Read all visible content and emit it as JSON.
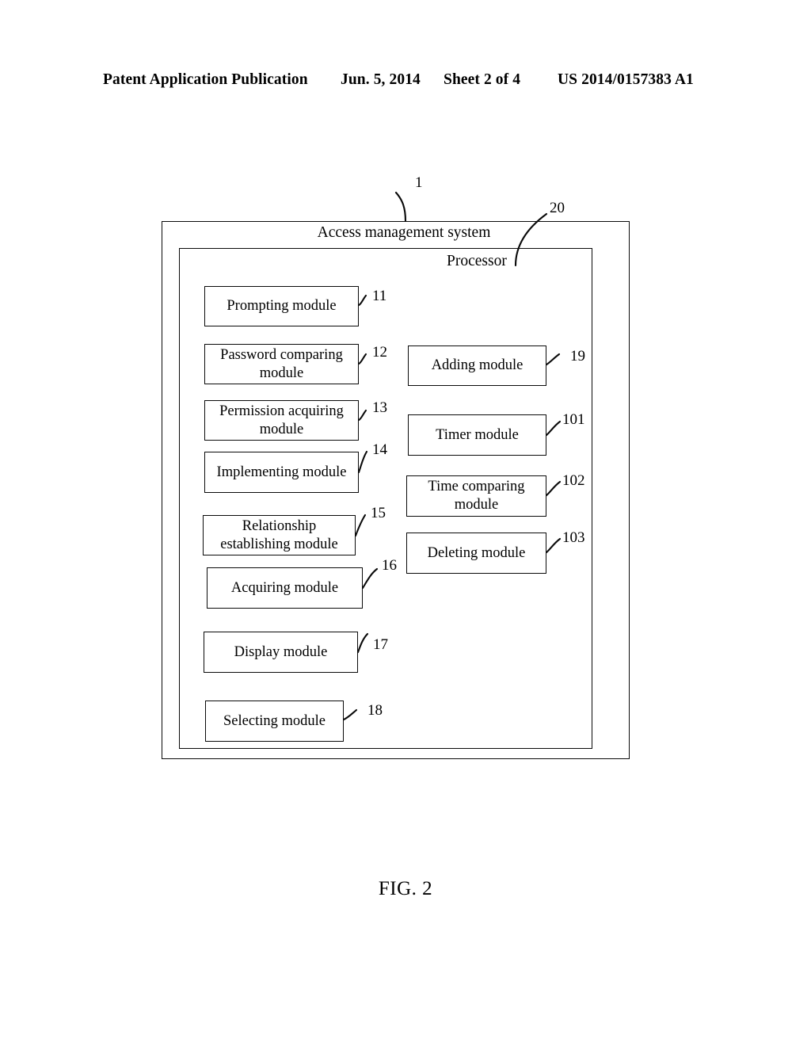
{
  "header": {
    "publication": "Patent Application Publication",
    "date": "Jun. 5, 2014",
    "sheet": "Sheet 2 of 4",
    "number": "US 2014/0157383 A1"
  },
  "figure": {
    "caption": "FIG. 2",
    "outer_container": {
      "label": "Access management system",
      "ref": "1"
    },
    "inner_container": {
      "label": "Processor",
      "ref": "20"
    },
    "left_column": [
      {
        "label": "Prompting module",
        "ref": "11"
      },
      {
        "label": "Password comparing module",
        "ref": "12"
      },
      {
        "label": "Permission acquiring module",
        "ref": "13"
      },
      {
        "label": "Implementing module",
        "ref": "14"
      },
      {
        "label": "Relationship establishing module",
        "ref": "15"
      },
      {
        "label": "Acquiring module",
        "ref": "16"
      },
      {
        "label": "Display module",
        "ref": "17"
      },
      {
        "label": "Selecting module",
        "ref": "18"
      }
    ],
    "right_column": [
      {
        "label": "Adding module",
        "ref": "19"
      },
      {
        "label": "Timer module",
        "ref": "101"
      },
      {
        "label": "Time comparing module",
        "ref": "102"
      },
      {
        "label": "Deleting module",
        "ref": "103"
      }
    ]
  }
}
